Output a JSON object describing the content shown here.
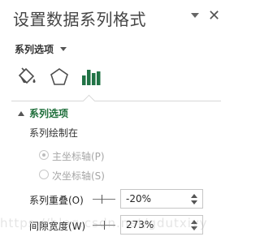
{
  "pane": {
    "title": "设置数据系列格式",
    "close_label": "✕"
  },
  "options_menu": {
    "label": "系列选项"
  },
  "tabs": [
    {
      "name": "fill-line",
      "icon": "paint-bucket-icon"
    },
    {
      "name": "effects",
      "icon": "pentagon-icon"
    },
    {
      "name": "series-options",
      "icon": "bar-chart-icon",
      "selected": true
    }
  ],
  "section": {
    "title": "系列选项",
    "plot_on_label": "系列绘制在",
    "primary_axis_label": "主坐标轴(P)",
    "secondary_axis_label": "次坐标轴(S)",
    "primary_selected": true,
    "overlap_label": "系列重叠(O)",
    "overlap_value": "-20%",
    "gap_label": "间隙宽度(W)",
    "gap_value": "273%"
  },
  "watermark": "https://blog.csdn.net/gdutxiyy",
  "colors": {
    "accent_green": "#1e6e3a",
    "icon_green": "#217346"
  }
}
